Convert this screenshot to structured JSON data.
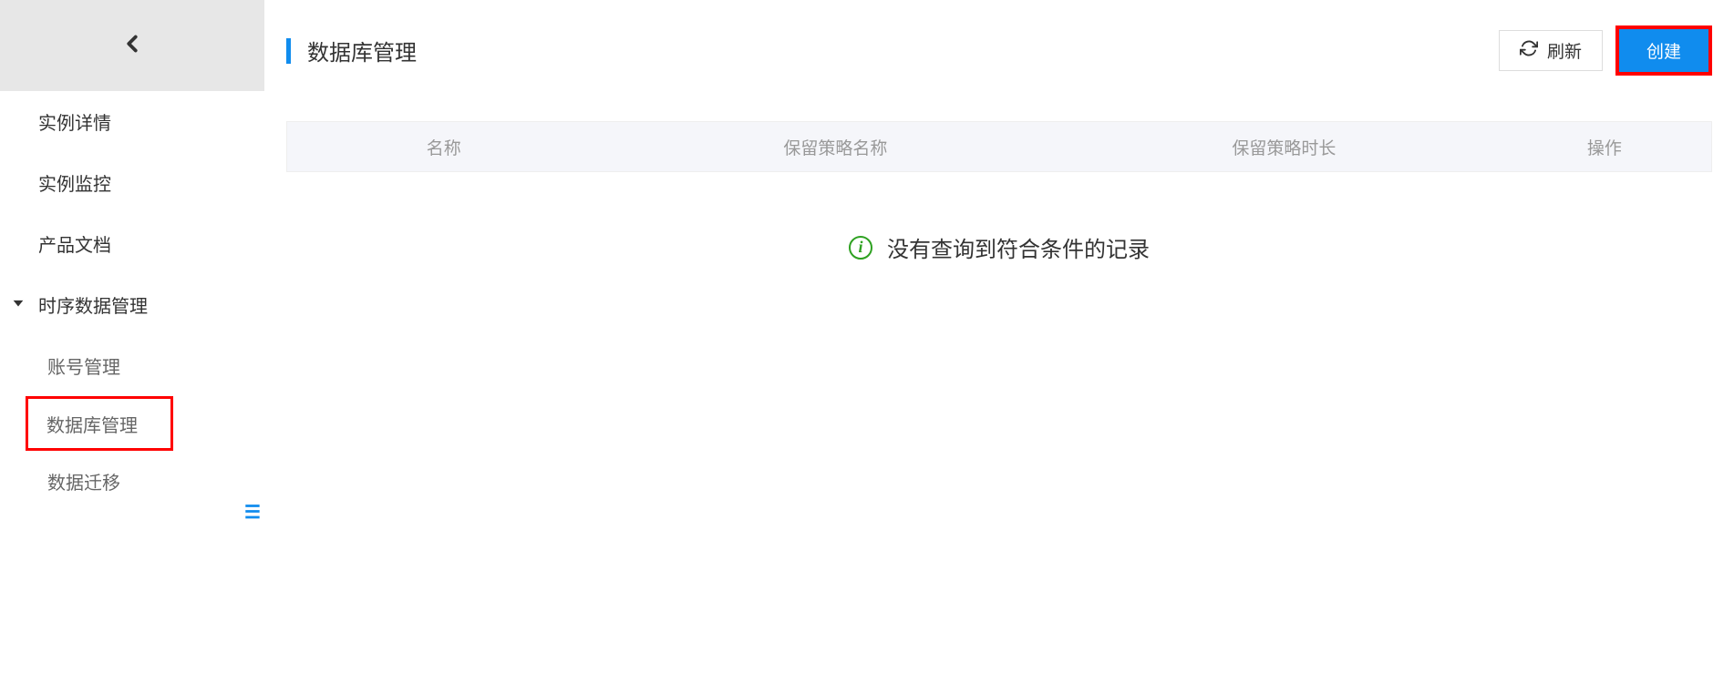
{
  "sidebar": {
    "items": [
      {
        "label": "实例详情"
      },
      {
        "label": "实例监控"
      },
      {
        "label": "产品文档"
      },
      {
        "label": "时序数据管理"
      },
      {
        "label": "账号管理"
      },
      {
        "label": "数据库管理"
      },
      {
        "label": "数据迁移"
      }
    ]
  },
  "page": {
    "title": "数据库管理"
  },
  "actions": {
    "refresh": "刷新",
    "create": "创建"
  },
  "table": {
    "headers": {
      "name": "名称",
      "policy_name": "保留策略名称",
      "policy_duration": "保留策略时长",
      "action": "操作"
    }
  },
  "empty": {
    "message": "没有查询到符合条件的记录",
    "icon_glyph": "i"
  },
  "collapse_glyph": "☰"
}
